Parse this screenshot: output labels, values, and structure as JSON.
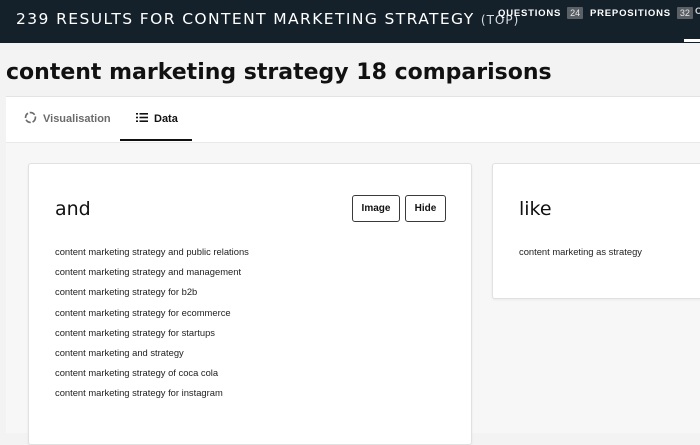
{
  "header": {
    "title": "239 RESULTS FOR CONTENT MARKETING STRATEGY",
    "title_suffix": "(TOP)",
    "nav": [
      {
        "label": "QUESTIONS",
        "count": "24"
      },
      {
        "label": "PREPOSITIONS",
        "count": "32"
      }
    ],
    "next_nav_partial": "C"
  },
  "page_title": "content marketing strategy 18 comparisons",
  "tabs": [
    {
      "label": "Visualisation",
      "icon": "circle-loading-icon",
      "active": false
    },
    {
      "label": "Data",
      "icon": "list-icon",
      "active": true
    }
  ],
  "cards": [
    {
      "title": "and",
      "buttons": {
        "image": "Image",
        "hide": "Hide"
      },
      "items": [
        "content marketing strategy and public relations",
        "content marketing strategy and management",
        "content marketing strategy for b2b",
        "content marketing strategy for ecommerce",
        "content marketing strategy for startups",
        "content marketing and strategy",
        "content marketing strategy of coca cola",
        "content marketing strategy for instagram"
      ]
    },
    {
      "title": "like",
      "items": [
        "content marketing as strategy"
      ]
    }
  ],
  "colors": {
    "header_bg": "#14212b",
    "badge_bg": "#5a6066",
    "page_bg": "#f3f3f3"
  }
}
